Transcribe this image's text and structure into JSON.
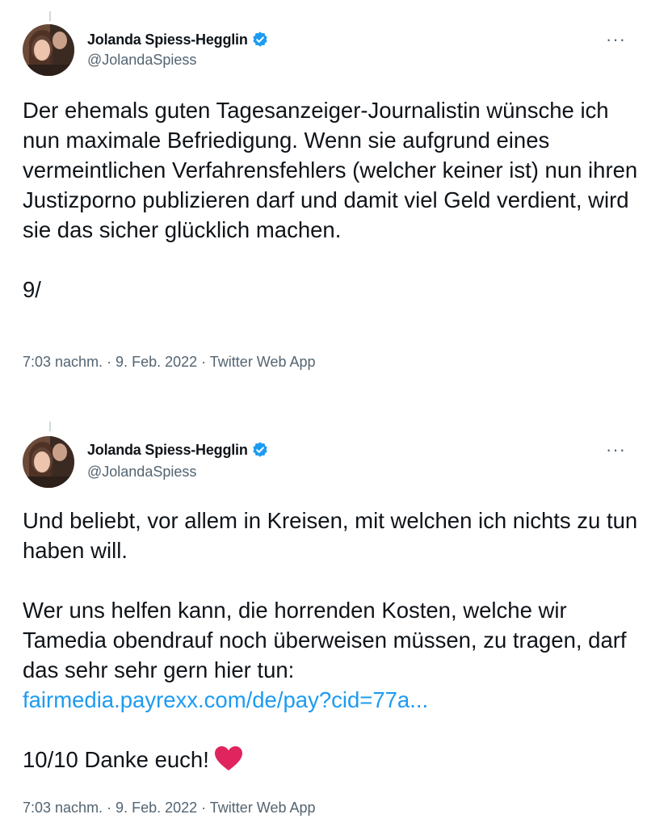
{
  "tweets": [
    {
      "author": {
        "name": "Jolanda Spiess-Hegglin",
        "handle": "@JolandaSpiess"
      },
      "more_label": "···",
      "paragraphs": [
        "Der ehemals guten Tagesanzeiger-Journalistin wünsche ich nun maximale Befriedigung. Wenn sie aufgrund eines vermeintlichen Verfahrensfehlers (welcher keiner ist) nun ihren Justizporno publizieren darf und damit viel Geld verdient, wird sie das sicher glücklich machen.",
        "9/"
      ],
      "meta": "7:03 nachm. · 9. Feb. 2022 · Twitter Web App"
    },
    {
      "author": {
        "name": "Jolanda Spiess-Hegglin",
        "handle": "@JolandaSpiess"
      },
      "more_label": "···",
      "paragraphs": [
        "Und beliebt, vor allem in Kreisen, mit welchen ich nichts zu tun haben will.",
        "Wer uns helfen kann, die horrenden Kosten, welche wir Tamedia obendrauf noch überweisen müssen, zu tragen, darf das sehr sehr gern hier tun:"
      ],
      "link": "fairmedia.payrexx.com/de/pay?cid=77a...",
      "closing": "10/10 Danke euch!",
      "meta": "7:03 nachm. · 9. Feb. 2022 · Twitter Web App"
    }
  ],
  "colors": {
    "text": "#0f1419",
    "secondary": "#536471",
    "link": "#1d9bf0",
    "verified": "#1d9bf0",
    "heart": "#e0245e"
  },
  "icons": {
    "verified": "verified-badge-icon",
    "more": "more-options-icon",
    "heart": "red-heart-emoji-icon"
  }
}
